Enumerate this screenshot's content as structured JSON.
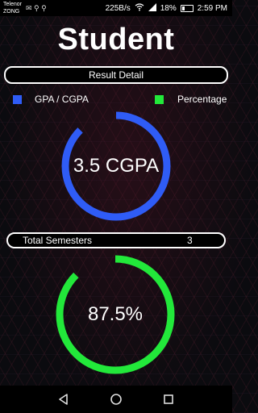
{
  "status_bar": {
    "carrier_line1": "Telenor",
    "carrier_line2": "ZONG",
    "left_icons": "✉ ⚲ ⚲",
    "speed": "225B/s",
    "battery": "18%",
    "time": "2:59 PM"
  },
  "header": {
    "title": "Student"
  },
  "result_detail": {
    "label": "Result Detail"
  },
  "legend": {
    "gpa_label": "GPA / CGPA",
    "gpa_color": "#2f5cf6",
    "percentage_label": "Percentage",
    "percentage_color": "#22e83a"
  },
  "gpa_ring": {
    "text": "3.5 CGPA",
    "value": 3.5,
    "max": 4.0,
    "fraction": 0.875,
    "color": "#2f5cf6"
  },
  "semesters": {
    "label": "Total Semesters",
    "value": "3"
  },
  "percentage_ring": {
    "text": "87.5%",
    "value": 87.5,
    "max": 100,
    "fraction": 0.875,
    "color": "#22e83a"
  },
  "navbar": {
    "back_icon": "back-triangle-icon",
    "home_icon": "home-circle-icon",
    "recent_icon": "recent-square-icon"
  }
}
